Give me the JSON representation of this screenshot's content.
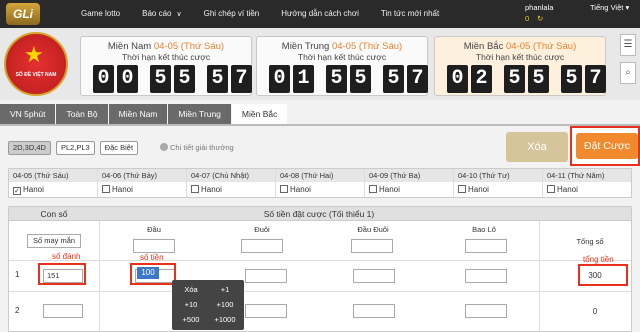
{
  "brand": {
    "logo_text": "GLi",
    "emblem_text": "SỐ ĐỀ VIỆT NAM"
  },
  "nav": {
    "items": [
      "Game lotto",
      "Báo cáo",
      "Ghi chép ví tiền",
      "Hướng dẫn cách chơi",
      "Tin tức mới nhất"
    ]
  },
  "user": {
    "name": "phanlala",
    "balance": "0",
    "language": "Tiếng Việt"
  },
  "regions": [
    {
      "name": "Miền Nam",
      "date": "04-05 (Thứ Sáu)",
      "subtitle": "Thời hạn kết thúc cược",
      "digits": [
        "0",
        "0",
        "5",
        "5",
        "5",
        "7"
      ]
    },
    {
      "name": "Miền Trung",
      "date": "04-05 (Thứ Sáu)",
      "subtitle": "Thời hạn kết thúc cược",
      "digits": [
        "0",
        "1",
        "5",
        "5",
        "5",
        "7"
      ]
    },
    {
      "name": "Miền Bắc",
      "date": "04-05 (Thứ Sáu)",
      "subtitle": "Thời hạn kết thúc cược",
      "digits": [
        "0",
        "2",
        "5",
        "5",
        "5",
        "7"
      ]
    }
  ],
  "tabs": [
    "VN 5phút",
    "Toàn Bộ",
    "Miền Nam",
    "Miền Trung",
    "Miền Bắc"
  ],
  "options": [
    "2D,3D,4D",
    "PL2,PL3",
    "Đặc Biệt"
  ],
  "detail_link": "Chi tiết giải thưởng",
  "buttons": {
    "clear": "Xóa",
    "place_bet": "Đặt Cược"
  },
  "dates": [
    {
      "label": "04-05 (Thứ Sáu)",
      "checked": true,
      "region": "Hanoi"
    },
    {
      "label": "04-06 (Thứ Bảy)",
      "checked": false,
      "region": "Hanoi"
    },
    {
      "label": "04-07 (Chủ Nhật)",
      "checked": false,
      "region": "Hanoi"
    },
    {
      "label": "04-08 (Thứ Hai)",
      "checked": false,
      "region": "Hanoi"
    },
    {
      "label": "04-09 (Thứ Ba)",
      "checked": false,
      "region": "Hanoi"
    },
    {
      "label": "04-10 (Thứ Tư)",
      "checked": false,
      "region": "Hanoi"
    },
    {
      "label": "04-11 (Thứ Năm)",
      "checked": false,
      "region": "Hanoi"
    }
  ],
  "bet_table": {
    "header_number": "Con số",
    "header_amount": "Số tiền đặt cược (Tối thiểu 1)",
    "random_button": "Số may mắn",
    "columns": [
      "Đầu",
      "Đuôi",
      "Đầu Đuôi",
      "Bao Lô"
    ],
    "total_header": "Tổng số",
    "rows": [
      {
        "index": "1",
        "number": "151",
        "dau": "100",
        "total": "300"
      },
      {
        "index": "2",
        "number": "",
        "dau": "",
        "total": "0"
      }
    ]
  },
  "annotations": {
    "number_label": "số đánh",
    "money_label": "số tiền",
    "total_label": "tổng tiền"
  },
  "keypad": [
    "Xóa",
    "+1",
    "+10",
    "+100",
    "+500",
    "+1000"
  ]
}
